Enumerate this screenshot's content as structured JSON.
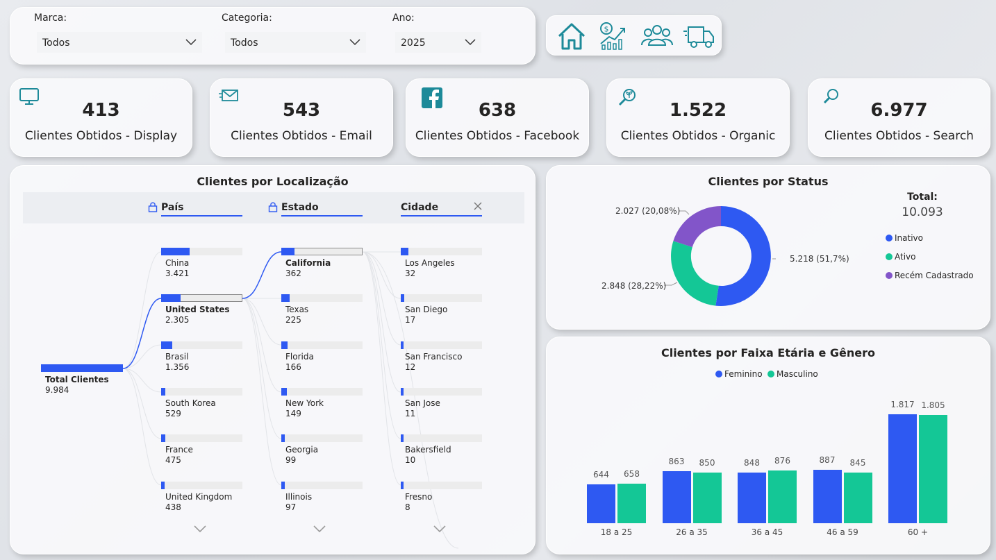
{
  "filters": {
    "marca": {
      "label": "Marca:",
      "value": "Todos"
    },
    "categoria": {
      "label": "Categoria:",
      "value": "Todos"
    },
    "ano": {
      "label": "Ano:",
      "value": "2025"
    }
  },
  "nav": [
    "home-icon",
    "finance-growth-icon",
    "customers-icon",
    "delivery-truck-icon"
  ],
  "kpis": [
    {
      "value": "413",
      "label": "Clientes Obtidos - Display",
      "icon": "monitor-icon"
    },
    {
      "value": "543",
      "label": "Clientes Obtidos - Email",
      "icon": "email-icon"
    },
    {
      "value": "638",
      "label": "Clientes Obtidos - Facebook",
      "icon": "facebook-icon"
    },
    {
      "value": "1.522",
      "label": "Clientes Obtidos - Organic",
      "icon": "organic-icon"
    },
    {
      "value": "6.977",
      "label": "Clientes Obtidos - Search",
      "icon": "search-icon"
    }
  ],
  "location": {
    "title": "Clientes por Localização",
    "levels": [
      "País",
      "Estado",
      "Cidade"
    ],
    "root": {
      "name": "Total Clientes",
      "value": "9.984"
    },
    "countries": [
      {
        "name": "China",
        "value": "3.421",
        "share": 0.35
      },
      {
        "name": "United States",
        "value": "2.305",
        "share": 0.24,
        "selected": true
      },
      {
        "name": "Brasil",
        "value": "1.356",
        "share": 0.14
      },
      {
        "name": "South Korea",
        "value": "529",
        "share": 0.055
      },
      {
        "name": "France",
        "value": "475",
        "share": 0.05
      },
      {
        "name": "United Kingdom",
        "value": "438",
        "share": 0.045
      }
    ],
    "states": [
      {
        "name": "California",
        "value": "362",
        "share": 0.16,
        "selected": true
      },
      {
        "name": "Texas",
        "value": "225",
        "share": 0.1
      },
      {
        "name": "Florida",
        "value": "166",
        "share": 0.075
      },
      {
        "name": "New York",
        "value": "149",
        "share": 0.065
      },
      {
        "name": "Georgia",
        "value": "99",
        "share": 0.045
      },
      {
        "name": "Illinois",
        "value": "97",
        "share": 0.043
      }
    ],
    "cities": [
      {
        "name": "Los Angeles",
        "value": "32",
        "share": 0.09
      },
      {
        "name": "San Diego",
        "value": "17",
        "share": 0.047
      },
      {
        "name": "San Francisco",
        "value": "12",
        "share": 0.033
      },
      {
        "name": "San Jose",
        "value": "11",
        "share": 0.03
      },
      {
        "name": "Bakersfield",
        "value": "10",
        "share": 0.028
      },
      {
        "name": "Fresno",
        "value": "8",
        "share": 0.022
      }
    ]
  },
  "status": {
    "title": "Clientes por Status",
    "total_label": "Total:",
    "total_value": "10.093",
    "colors": {
      "Inativo": "#2e59f2",
      "Ativo": "#14c796",
      "Recém Cadastrado": "#8255c9"
    },
    "legend": [
      "Inativo",
      "Ativo",
      "Recém Cadastrado"
    ],
    "labels": {
      "inativo": "5.218 (51,7%)",
      "ativo": "2.848 (28,22%)",
      "recem": "2.027 (20,08%)"
    }
  },
  "chart_data": {
    "type": "bar",
    "title": "Clientes por Faixa Etária e Gênero",
    "categories": [
      "18 a 25",
      "26 a 35",
      "36 a 45",
      "46 a 59",
      "60 +"
    ],
    "series": [
      {
        "name": "Feminino",
        "values": [
          644,
          863,
          848,
          887,
          1817
        ],
        "labels": [
          "644",
          "863",
          "848",
          "887",
          "1.817"
        ],
        "color": "#2e59f2"
      },
      {
        "name": "Masculino",
        "values": [
          658,
          850,
          876,
          845,
          1805
        ],
        "labels": [
          "658",
          "850",
          "876",
          "845",
          "1.805"
        ],
        "color": "#14c796"
      }
    ],
    "legend_position": "top-center"
  }
}
